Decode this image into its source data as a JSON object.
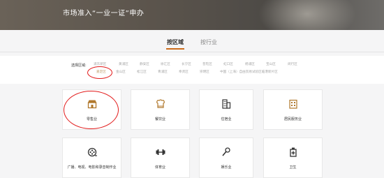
{
  "banner": {
    "title": "市场准入“一业一证”申办"
  },
  "tabs": [
    {
      "label": "按区域",
      "active": true
    },
    {
      "label": "按行业",
      "active": false
    }
  ],
  "district_filter": {
    "label": "选择区域:",
    "row1": [
      "浦东新区",
      "黄浦区",
      "静安区",
      "徐汇区",
      "长宁区",
      "普陀区",
      "虹口区",
      "杨浦区",
      "宝山区",
      "闵行区"
    ],
    "row2": [
      "嘉定区",
      "金山区",
      "松江区",
      "青浦区",
      "奉贤区",
      "崇明区",
      "中国（上海）自由贸易试验区临港新片区"
    ],
    "selected": "嘉定区"
  },
  "industries": [
    {
      "label": "零售业",
      "icon": "store-icon"
    },
    {
      "label": "餐饮业",
      "icon": "chef-hat-icon"
    },
    {
      "label": "住宿业",
      "icon": "hotel-building-icon"
    },
    {
      "label": "居民服务业",
      "icon": "resident-services-icon"
    },
    {
      "label": "广播、电视、电影和录音制作业",
      "icon": "film-reel-icon"
    },
    {
      "label": "体育业",
      "icon": "dumbbell-icon"
    },
    {
      "label": "娱乐业",
      "icon": "microphone-icon"
    },
    {
      "label": "卫生",
      "icon": "medicine-bottle-icon"
    }
  ],
  "colors": {
    "accent": "#cc6b1a",
    "icon": "#b0782c",
    "annotation": "#e21b1b"
  }
}
